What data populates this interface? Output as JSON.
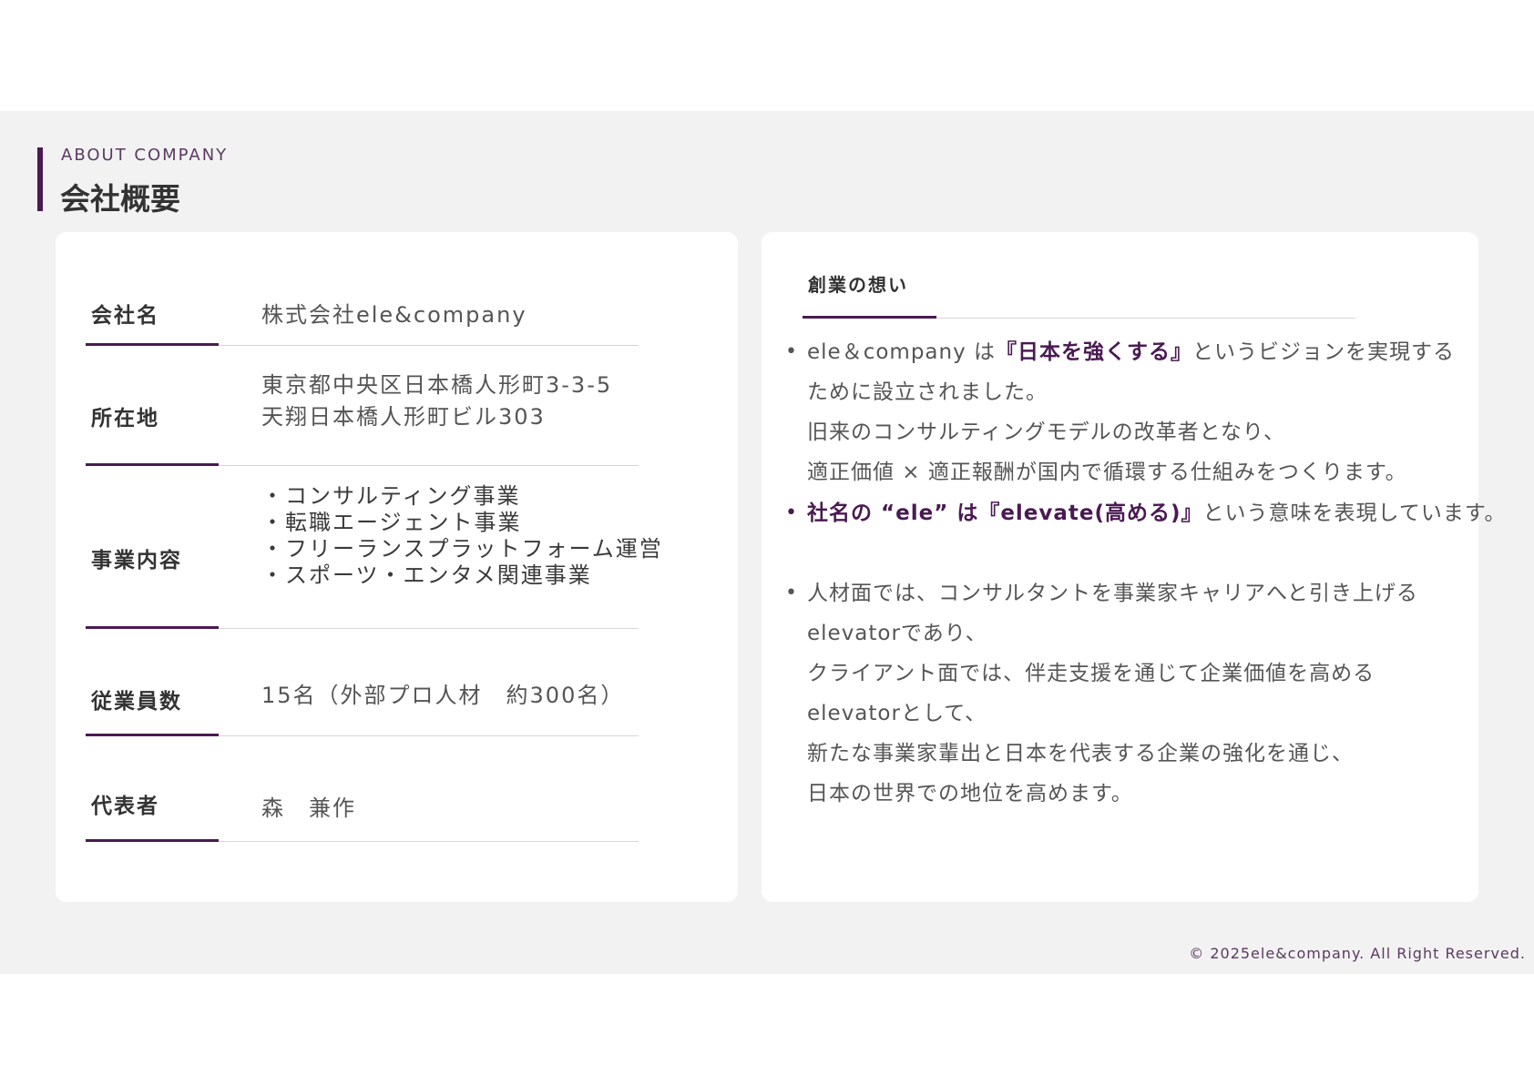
{
  "header": {
    "eyebrow": "ABOUT COMPANY",
    "title": "会社概要"
  },
  "company_info": {
    "rows": [
      {
        "label": "会社名",
        "lines": [
          "株式会社ele&company"
        ]
      },
      {
        "label": "所在地",
        "lines": [
          "東京都中央区日本橋人形町3-3-5",
          "天翔日本橋人形町ビル303"
        ]
      },
      {
        "label": "事業内容",
        "lines": [
          "・コンサルティング事業",
          "・転職エージェント事業",
          "・フリーランスプラットフォーム運営",
          "・スポーツ・エンタメ関連事業"
        ]
      },
      {
        "label": "従業員数",
        "lines": [
          "15名（外部プロ人材　約300名）"
        ]
      },
      {
        "label": "代表者",
        "lines": [
          "森　兼作"
        ]
      }
    ]
  },
  "founding": {
    "tab_label": "創業の想い",
    "p1": {
      "l1_pre": "ele＆company は",
      "l1_hl": "『日本を強くする』",
      "l1_post": "というビジョンを実現する",
      "l2": "ために設立されました。",
      "l3": "旧来のコンサルティングモデルの改革者となり、",
      "l4": "適正価値 × 適正報酬が国内で循環する仕組みをつくります。"
    },
    "p2": {
      "hl": "社名の “ele” は『elevate(高める)』",
      "post": "という意味を表現しています。"
    },
    "p3": {
      "l1": "人材面では、コンサルタントを事業家キャリアへと引き上げる",
      "l2": "elevatorであり、",
      "l3": "クライアント面では、伴走支援を通じて企業価値を高める",
      "l4": "elevatorとして、",
      "l5": "新たな事業家輩出と日本を代表する企業の強化を通じ、",
      "l6": "日本の世界での地位を高めます。"
    }
  },
  "footer": {
    "copyright": "© 2025ele&company. All Right Reserved."
  },
  "colors": {
    "accent": "#4a1a52",
    "background": "#f2f2f2",
    "card": "#ffffff"
  }
}
